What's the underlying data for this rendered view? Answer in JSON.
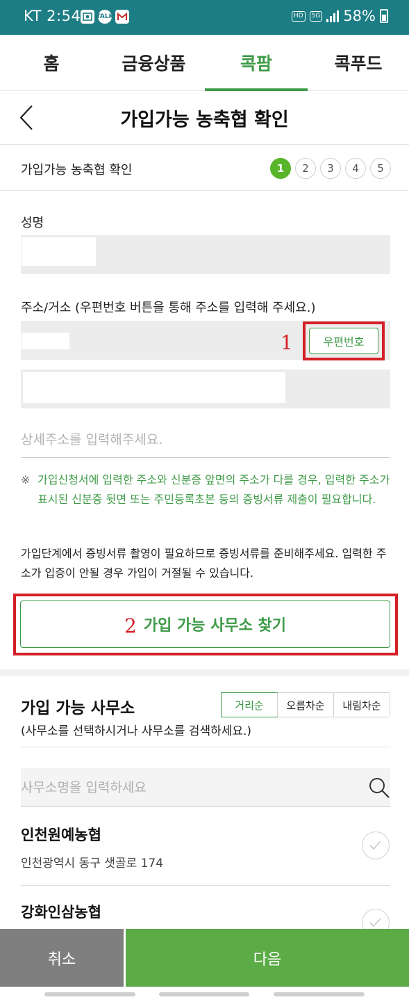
{
  "status_bar": {
    "carrier_time": "KT 2:54",
    "left_icons": [
      "photo-icon",
      "talk-icon",
      "mail-icon"
    ],
    "talk_label": "TALK",
    "hd_label": "HD",
    "network_label": "5G",
    "battery": "58%"
  },
  "top_nav": {
    "tabs": [
      {
        "label": "홈",
        "active": false
      },
      {
        "label": "금융상품",
        "active": false
      },
      {
        "label": "콕팜",
        "active": true
      },
      {
        "label": "콕푸드",
        "active": false
      }
    ]
  },
  "page": {
    "title": "가입가능 농축협 확인"
  },
  "step_row": {
    "label": "가입가능 농축협 확인",
    "steps": [
      "1",
      "2",
      "3",
      "4",
      "5"
    ],
    "current_step": "1"
  },
  "form": {
    "name_label": "성명",
    "address_label": "주소/거소 (우편번호 버튼을 통해 주소를 입력해 주세요.)",
    "zip_button": "우편번호",
    "annotation_1": "1",
    "detail_placeholder": "상세주소를 입력해주세요.",
    "notice_mark": "※",
    "notice_text": "가입신청서에 입력한 주소와 신분증 앞면의 주소가 다를 경우, 입력한 주소가 표시된 신분증 뒷면 또는 주민등록초본 등의 증빙서류 제출이 필요합니다.",
    "guide_text": "가입단계에서 증빙서류 촬영이 필요하므로 증빙서류를 준비해주세요. 입력한 주소가 입증이 안될 경우 가입이 거절될 수 있습니다.",
    "find_button": "가입 가능 사무소 찾기",
    "annotation_2": "2"
  },
  "offices": {
    "title": "가입 가능 사무소",
    "hint": "(사무소를 선택하시거나 사무소를 검색하세요.)",
    "sort_options": [
      {
        "label": "거리순",
        "active": true
      },
      {
        "label": "오름차순",
        "active": false
      },
      {
        "label": "내림차순",
        "active": false
      }
    ],
    "search_placeholder": "사무소명을 입력하세요",
    "items": [
      {
        "name": "인천원예농협",
        "address": "인천광역시 동구 샛골로 174"
      },
      {
        "name": "강화인삼농협",
        "address": ""
      }
    ]
  },
  "bottom_bar": {
    "cancel": "취소",
    "next": "다음"
  },
  "colors": {
    "status_bar": "#1c7d84",
    "accent_green": "#3d9a46",
    "step_green": "#58b52a",
    "next_button": "#5bab47",
    "cancel_button": "#7f7f7f",
    "annotation_red": "#d51f26"
  }
}
